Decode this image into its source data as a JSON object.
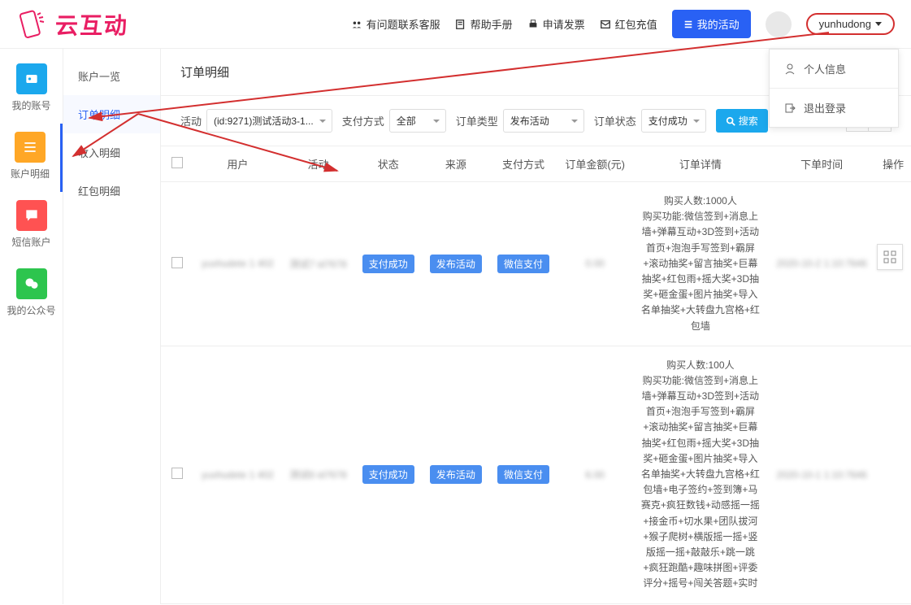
{
  "brand": "云互动",
  "header": {
    "links": {
      "contact": "有问题联系客服",
      "help": "帮助手册",
      "invoice": "申请发票",
      "recharge": "红包充值"
    },
    "my_activities": "我的活动",
    "username": "yunhudong"
  },
  "dropdown": {
    "profile": "个人信息",
    "logout": "退出登录"
  },
  "sidebar": {
    "items": [
      {
        "label": "我的账号",
        "color": "#1ba8ed"
      },
      {
        "label": "账户明细",
        "color": "#ffa726"
      },
      {
        "label": "短信账户",
        "color": "#ff5252"
      },
      {
        "label": "我的公众号",
        "color": "#2dc54e"
      }
    ]
  },
  "submenu": {
    "items": [
      "账户一览",
      "订单明细",
      "收入明细",
      "红包明细"
    ]
  },
  "page_title": "订单明细",
  "filters": {
    "activity_label": "活动",
    "activity_value": "(id:9271)测试活动3-1...",
    "pay_method_label": "支付方式",
    "pay_method_value": "全部",
    "order_type_label": "订单类型",
    "order_type_value": "发布活动",
    "order_status_label": "订单状态",
    "order_status_value": "支付成功",
    "search": "搜索"
  },
  "table": {
    "headers": [
      "用户",
      "活动",
      "状态",
      "来源",
      "支付方式",
      "订单金额(元)",
      "订单详情",
      "下单时间",
      "操作"
    ],
    "rows": [
      {
        "user": "yuxhudete 1 402",
        "activity": "测试7 id7678",
        "status": "支付成功",
        "source": "发布活动",
        "pay_method": "微信支付",
        "amount": "0.00",
        "details": "购买人数:1000人\n购买功能:微信签到+消息上墙+弹幕互动+3D签到+活动首页+泡泡手写签到+霸屏+滚动抽奖+留言抽奖+巨幕抽奖+红包雨+摇大奖+3D抽奖+砸金蛋+图片抽奖+导入名单抽奖+大转盘九宫格+红包墙",
        "time": "2020-10-2 1:10:7646"
      },
      {
        "user": "yuxhudete 1 402",
        "activity": "测试6 id7678",
        "status": "支付成功",
        "source": "发布活动",
        "pay_method": "微信支付",
        "amount": "6.00",
        "details": "购买人数:100人\n购买功能:微信签到+消息上墙+弹幕互动+3D签到+活动首页+泡泡手写签到+霸屏+滚动抽奖+留言抽奖+巨幕抽奖+红包雨+摇大奖+3D抽奖+砸金蛋+图片抽奖+导入名单抽奖+大转盘九宫格+红包墙+电子签约+签到簿+马赛克+疯狂数钱+动感摇一摇+接金币+切水果+团队拔河+猴子爬树+横版摇一摇+竖版摇一摇+敲敲乐+跳一跳+疯狂跑酷+趣味拼图+评委评分+摇号+闯关答题+实时",
        "time": "2020-10-1 1:10:7646"
      }
    ]
  }
}
